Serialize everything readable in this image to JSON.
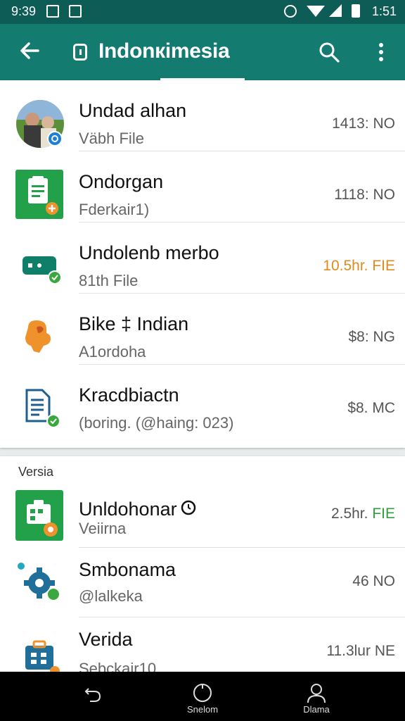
{
  "status_bar": {
    "time_left": "9:39",
    "time_right": "1:51"
  },
  "app_bar": {
    "title": "Indonкimesia"
  },
  "list_one": [
    {
      "primary": "Undad alhan",
      "secondary": "Väbh File",
      "meta": "1413: NO",
      "icon": "avatar-photo"
    },
    {
      "primary": "Ondorgan",
      "secondary": "Fderkair1)",
      "meta": "1118: NO",
      "icon": "document-icon"
    },
    {
      "primary": "Undolenb merbo",
      "secondary": "81th File",
      "meta": "10.5hr. FIE",
      "icon": "ticket-icon"
    },
    {
      "primary": "Bike ‡ Indian",
      "secondary": "A1ordoha",
      "meta": "$8: NG",
      "icon": "puzzle-icon"
    },
    {
      "primary": "Kracdbiactn",
      "secondary": "(boring. (@haing: 023)",
      "meta": "$8. MC",
      "icon": "file-icon"
    }
  ],
  "section_label": "Versia",
  "list_two": [
    {
      "primary": "Unldohonar",
      "secondary": "Veiirna",
      "meta_main": "2.5hr.",
      "meta_suffix": "FIE",
      "icon": "calendar-icon"
    },
    {
      "primary": "Smbonama",
      "secondary": "@lalkeka",
      "meta": "46 NO",
      "icon": "settings-icon"
    },
    {
      "primary": "Verida",
      "secondary": "Sebckair10",
      "meta": "11.3lur NE",
      "icon": "briefcase-icon"
    }
  ],
  "nav": {
    "home_label": "Snelom",
    "profile_label": "Dlama"
  },
  "colors": {
    "status_bar": "#0d5d56",
    "app_bar": "#137b70",
    "accent_orange": "#f0922b",
    "accent_green": "#2e9e3f"
  }
}
